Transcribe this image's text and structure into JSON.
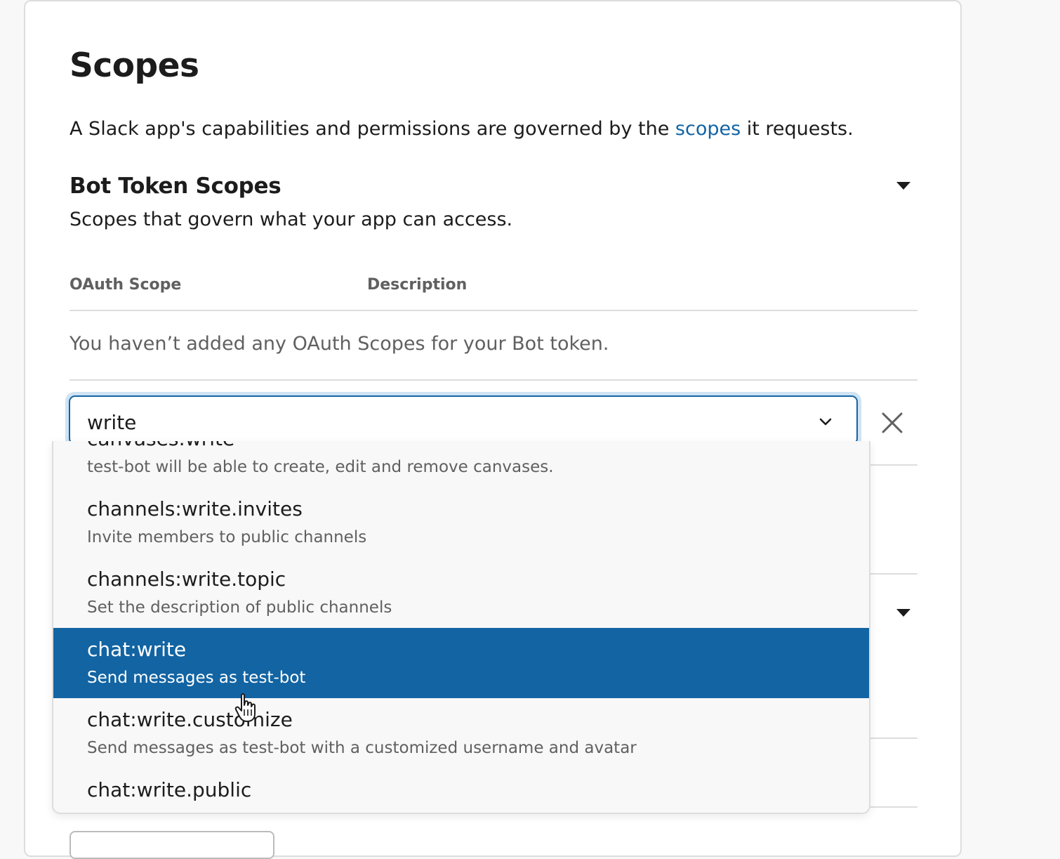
{
  "page": {
    "title": "Scopes",
    "intro_before_link": "A Slack app's capabilities and permissions are governed by the ",
    "intro_link": "scopes",
    "intro_after_link": " it requests."
  },
  "bot_section": {
    "title": "Bot Token Scopes",
    "subtitle": "Scopes that govern what your app can access.",
    "col_scope": "OAuth Scope",
    "col_description": "Description",
    "empty_message": "You haven’t added any OAuth Scopes for your Bot token."
  },
  "scope_select": {
    "value": "write",
    "options": [
      {
        "name": "canvases:write",
        "desc": "test-bot will be able to create, edit and remove canvases."
      },
      {
        "name": "channels:write.invites",
        "desc": "Invite members to public channels"
      },
      {
        "name": "channels:write.topic",
        "desc": "Set the description of public channels"
      },
      {
        "name": "chat:write",
        "desc": "Send messages as test-bot",
        "selected": true
      },
      {
        "name": "chat:write.customize",
        "desc": "Send messages as test-bot with a customized username and avatar"
      },
      {
        "name": "chat:write.public",
        "desc": ""
      }
    ]
  },
  "icons": {
    "collapse_caret": "caret-down-icon",
    "select_chevron": "chevron-down-icon",
    "remove": "close-icon",
    "cursor": "pointer-hand-icon"
  },
  "colors": {
    "accent": "#1264a3",
    "selected_bg": "#1264a3",
    "focus_ring": "#cfe3f3"
  }
}
